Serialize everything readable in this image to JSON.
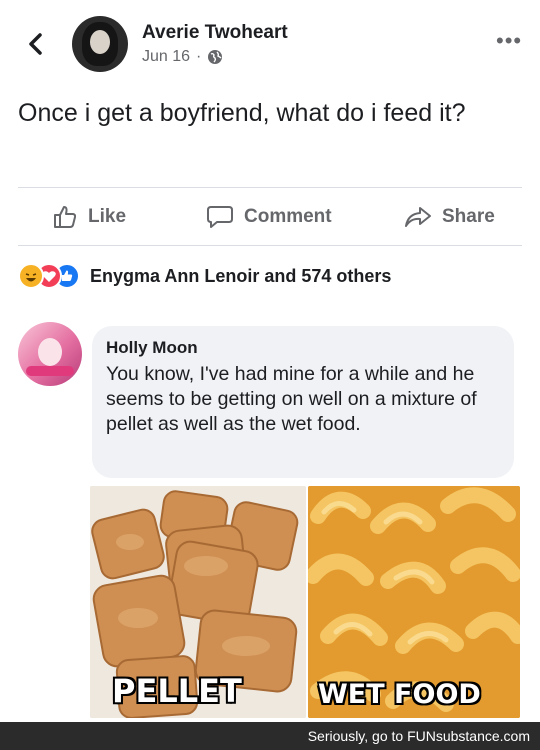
{
  "post": {
    "author": "Averie Twoheart",
    "date": "Jun 16",
    "separator": "·",
    "privacy_icon": "globe-icon",
    "text": "Once i get a boyfriend, what do i feed it?"
  },
  "actions": {
    "like_label": "Like",
    "comment_label": "Comment",
    "share_label": "Share"
  },
  "reactions": {
    "icons": [
      "haha-icon",
      "love-icon",
      "like-icon"
    ],
    "summary": "Enygma Ann Lenoir and 574 others"
  },
  "comment": {
    "author": "Holly Moon",
    "text": "You know, I've had mine for a while and he seems to be getting on well on a mixture of pellet as well as the wet food.",
    "photos": [
      {
        "label": "PELLET"
      },
      {
        "label": "WET FOOD"
      }
    ]
  },
  "footer": {
    "credit": "Seriously, go to FUNsubstance.com"
  },
  "colors": {
    "text": "#1c1e21",
    "secondary": "#65676b",
    "bubble": "#f0f2f5",
    "like_blue": "#1877f2",
    "love_red": "#f33e58",
    "haha_yellow": "#f7b125"
  }
}
